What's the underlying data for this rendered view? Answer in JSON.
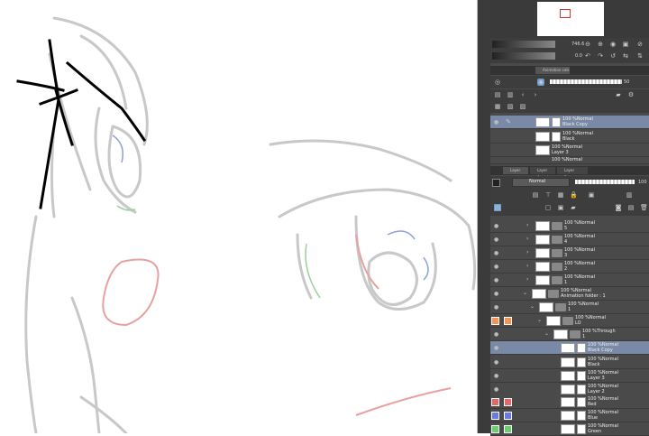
{
  "toolbar": {
    "zoom_value": "746.6",
    "rotate_value": "0.0",
    "opacity_value": "50",
    "animation_tab_label": "Animation cels",
    "blend_mode": "Normal",
    "opacity_right": "100",
    "layer_tabs": [
      "Layer",
      "Layer Search",
      "Layer Property"
    ]
  },
  "cels_list": [
    {
      "pct": "100 %Normal",
      "name": "Black Copy"
    },
    {
      "pct": "100 %Normal",
      "name": "Black"
    },
    {
      "pct": "100 %Normal",
      "name": "Layer 3"
    },
    {
      "pct": "100 %Normal",
      "name": ""
    }
  ],
  "layers": [
    {
      "pct": "100 %Normal",
      "name": "5"
    },
    {
      "pct": "100 %Normal",
      "name": "4"
    },
    {
      "pct": "100 %Normal",
      "name": "3"
    },
    {
      "pct": "100 %Normal",
      "name": "2"
    },
    {
      "pct": "100 %Normal",
      "name": "1"
    },
    {
      "pct": "100 %Normal",
      "name": "Animation folder : 1"
    },
    {
      "pct": "100 %Normal",
      "name": "1"
    },
    {
      "pct": "100 %Normal",
      "name": "LO"
    },
    {
      "pct": "100 %Through",
      "name": "1"
    },
    {
      "pct": "100 %Normal",
      "name": "Black Copy"
    },
    {
      "pct": "100 %Normal",
      "name": "Black"
    },
    {
      "pct": "100 %Normal",
      "name": "Layer 3"
    },
    {
      "pct": "100 %Normal",
      "name": "Layer 2"
    },
    {
      "pct": "100 %Normal",
      "name": "Red"
    },
    {
      "pct": "100 %Normal",
      "name": "Blue"
    },
    {
      "pct": "100 %Normal",
      "name": "Green"
    }
  ],
  "colors": {
    "red_tag": "#e06a6a",
    "blue_tag": "#6a7ae0",
    "green_tag": "#6ad06a",
    "orange_tag": "#f0955a",
    "selected": "#7a8aa6"
  }
}
